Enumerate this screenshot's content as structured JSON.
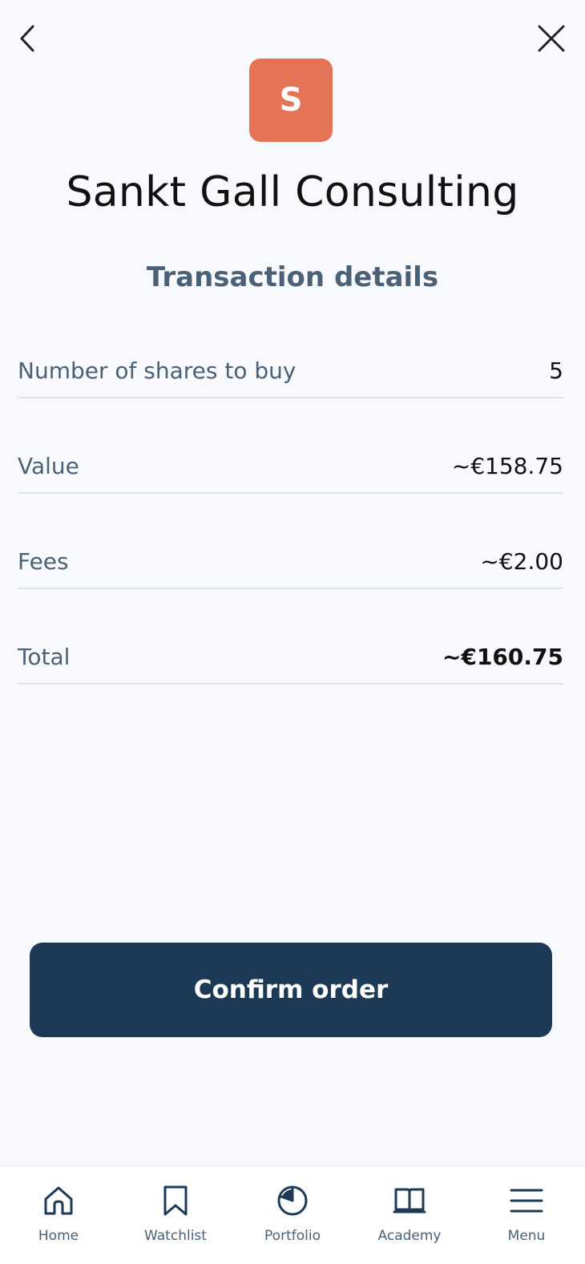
{
  "header": {
    "back_icon": "chevron-left-icon",
    "close_icon": "close-icon"
  },
  "company": {
    "logo_letter": "S",
    "logo_color": "#e57356",
    "name": "Sankt Gall Consulting"
  },
  "section_title": "Transaction details",
  "details": [
    {
      "label": "Number of shares to buy",
      "value": "5"
    },
    {
      "label": "Value",
      "value": "~€158.75"
    },
    {
      "label": "Fees",
      "value": "~€2.00"
    },
    {
      "label": "Total",
      "value": "~€160.75"
    }
  ],
  "confirm_label": "Confirm order",
  "nav": [
    {
      "label": "Home",
      "icon": "home-icon"
    },
    {
      "label": "Watchlist",
      "icon": "bookmark-icon"
    },
    {
      "label": "Portfolio",
      "icon": "pie-chart-icon"
    },
    {
      "label": "Academy",
      "icon": "book-icon"
    },
    {
      "label": "Menu",
      "icon": "menu-icon"
    }
  ],
  "colors": {
    "primary": "#1c3a55",
    "label": "#4a6178",
    "logo": "#e57356"
  }
}
